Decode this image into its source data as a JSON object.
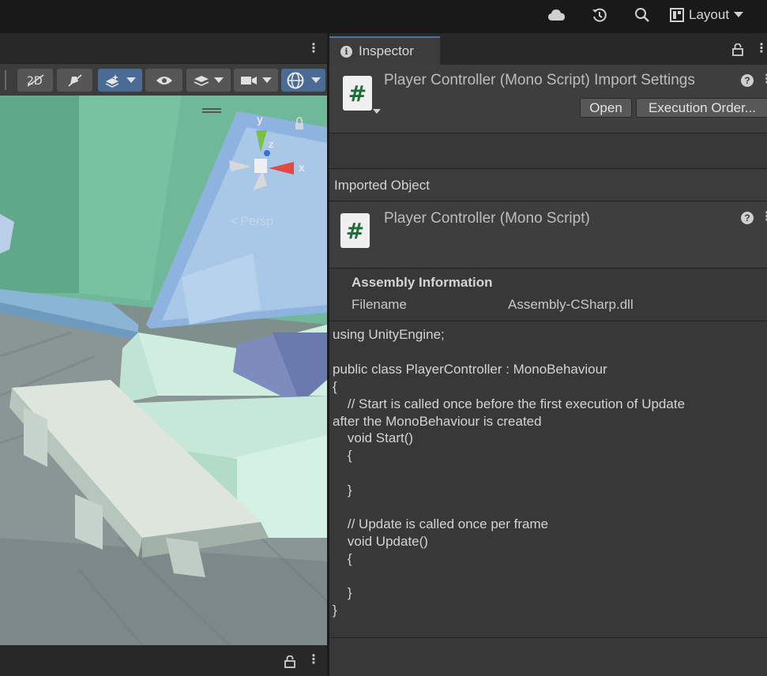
{
  "toolbar": {
    "icons": [
      "cloud-icon",
      "history-icon",
      "search-icon"
    ],
    "layout_label": "Layout"
  },
  "scene": {
    "orientation_labels": {
      "y": "y",
      "z": "z",
      "x": "x"
    },
    "projection_label": "Persp"
  },
  "inspector": {
    "tab_label": "Inspector",
    "header_title": "Player Controller (Mono Script) Import Settings",
    "open_button": "Open",
    "execution_order_button": "Execution Order...",
    "imported_object_label": "Imported Object",
    "object_title": "Player Controller (Mono Script)",
    "file_glyph": "#",
    "help_glyph": "?",
    "assembly": {
      "title": "Assembly Information",
      "filename_label": "Filename",
      "filename_value": "Assembly-CSharp.dll"
    },
    "code_lines": [
      "using UnityEngine;",
      "",
      "public class PlayerController : MonoBehaviour",
      "{",
      "    // Start is called once before the first execution of Update",
      "after the MonoBehaviour is created",
      "    void Start()",
      "    {",
      "",
      "    }",
      "",
      "    // Update is called once per frame",
      "    void Update()",
      "    {",
      "",
      "    }",
      "}"
    ]
  }
}
